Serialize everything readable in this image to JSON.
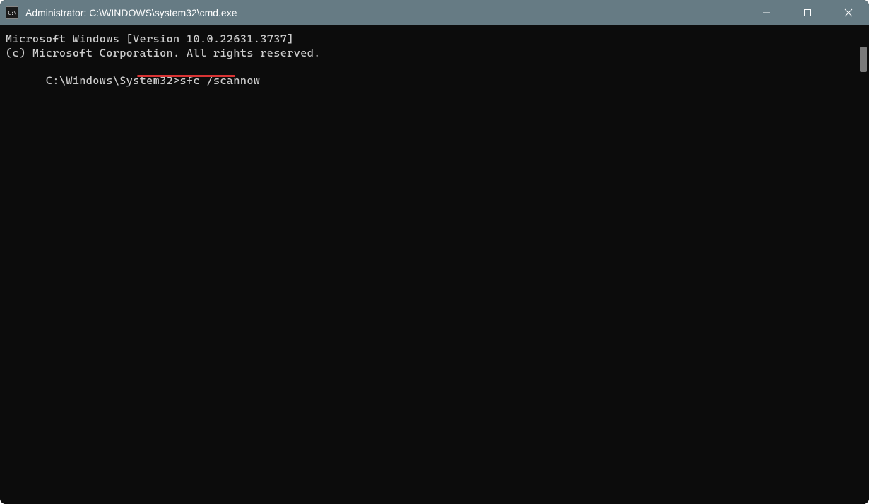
{
  "window": {
    "title": "Administrator: C:\\WINDOWS\\system32\\cmd.exe",
    "icon_label": "C:\\"
  },
  "terminal": {
    "line1": "Microsoft Windows [Version 10.0.22631.3737]",
    "line2": "(c) Microsoft Corporation. All rights reserved.",
    "blank": "",
    "prompt": "C:\\Windows\\System32>",
    "command": "sfc /scannow"
  },
  "annotation": {
    "underline_target": "sfc /scannow",
    "color": "#d93434"
  }
}
